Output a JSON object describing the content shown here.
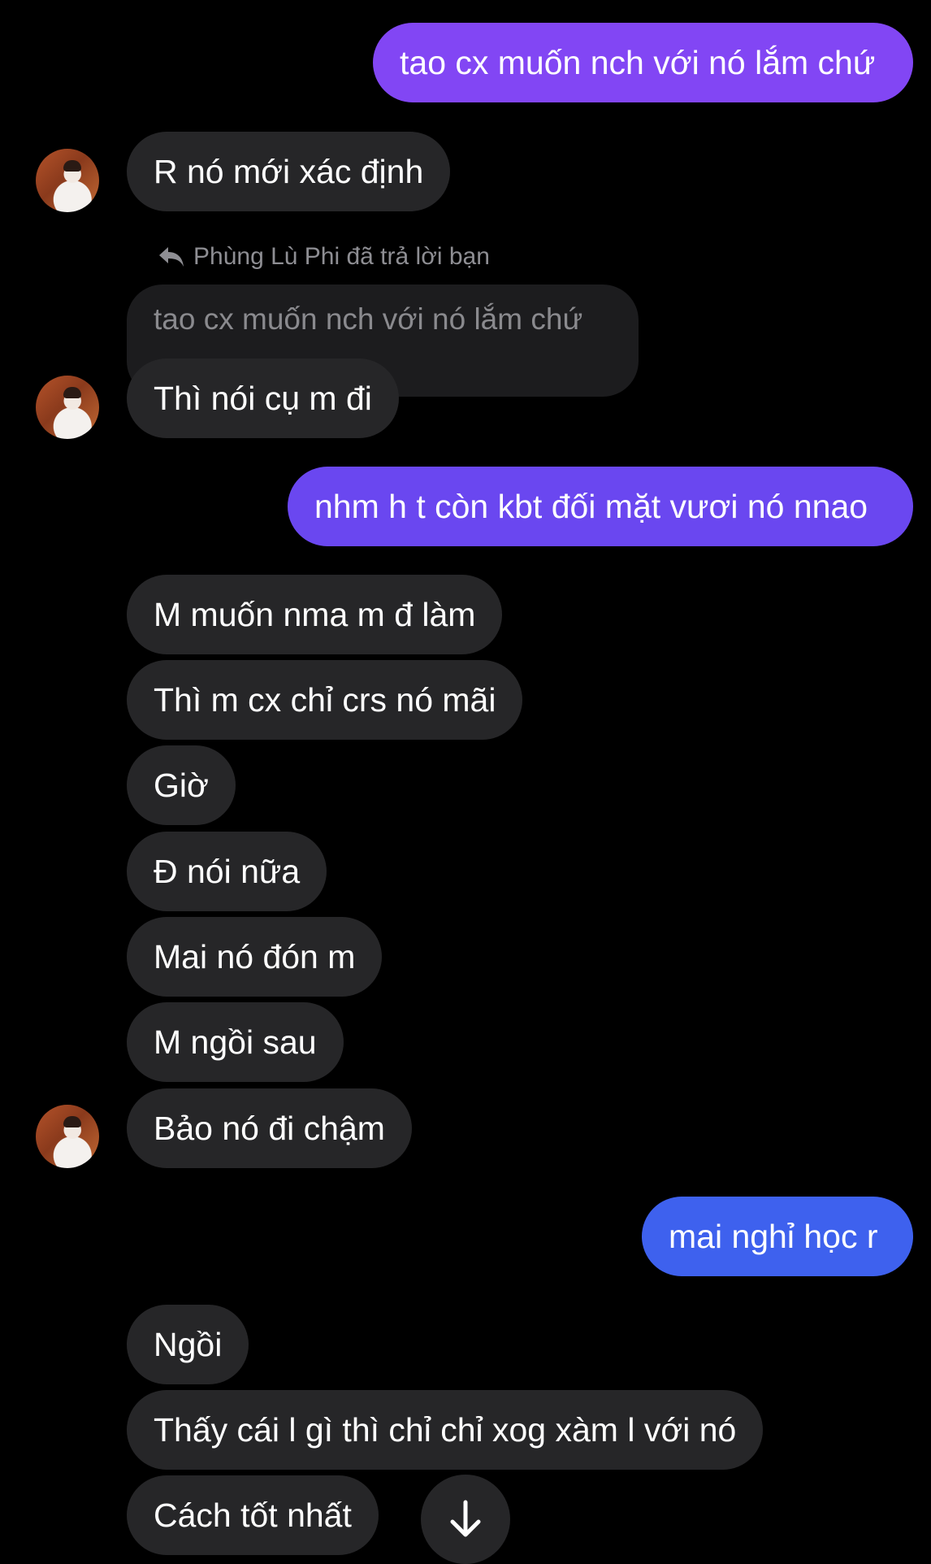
{
  "colors": {
    "background": "#000000",
    "incoming_bubble": "#262628",
    "outgoing_purple": "#8246f4",
    "outgoing_indigo": "#6a47f0",
    "outgoing_blue": "#3e61ee",
    "quoted_bubble": "#1c1c1e"
  },
  "messages": {
    "out1": "tao cx muốn nch với nó lắm chứ",
    "in1": "R nó mới xác định",
    "reply_header": "Phùng Lù Phi đã trả lời bạn",
    "quoted": "tao cx muốn nch với nó lắm chứ",
    "in2": "Thì nói cụ m đi",
    "out2": "nhm h t còn kbt đối mặt vươi nó nnao",
    "in3": "M muốn nma m đ làm",
    "in4": "Thì m cx chỉ crs nó mãi",
    "in5": "Giờ",
    "in6": "Đ nói nữa",
    "in7": "Mai nó đón m",
    "in8": "M ngồi sau",
    "in9": "Bảo nó đi chậm",
    "out3": "mai nghỉ học r",
    "in10": "Ngồi",
    "in11": "Thấy cái l gì thì chỉ chỉ xog xàm l với nó",
    "in12": "Cách tốt nhất"
  },
  "icons": {
    "reply": "reply-arrow-icon",
    "scroll_down": "arrow-down-icon",
    "avatar": "contact-avatar"
  }
}
